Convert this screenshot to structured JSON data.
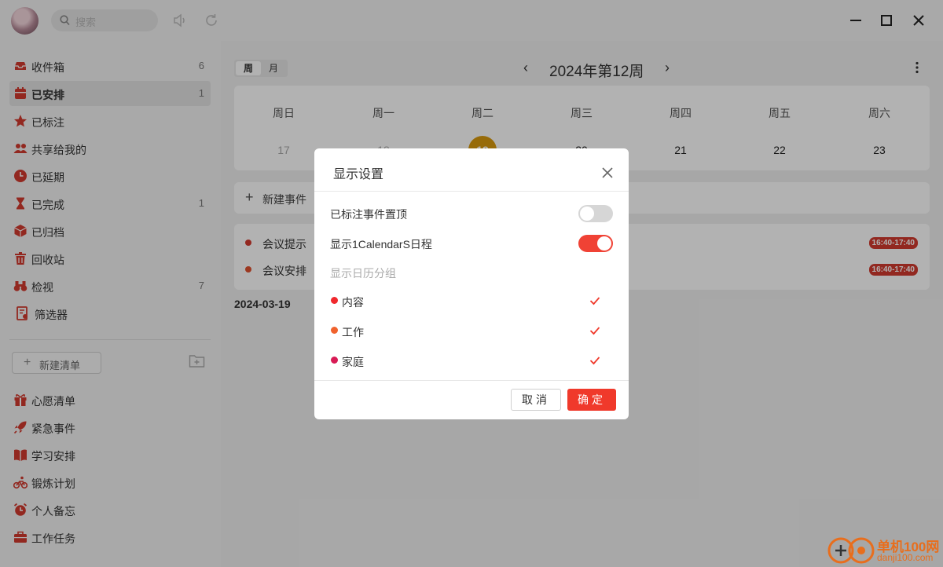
{
  "titlebar": {
    "search_placeholder": "搜索"
  },
  "sidebar": {
    "smart_lists": [
      {
        "label": "收件箱",
        "count": "6",
        "icon": "inbox-icon"
      },
      {
        "label": "已安排",
        "count": "1",
        "icon": "calendar-icon",
        "active": true
      },
      {
        "label": "已标注",
        "count": "",
        "icon": "star-icon"
      },
      {
        "label": "共享给我的",
        "count": "",
        "icon": "people-icon"
      },
      {
        "label": "已延期",
        "count": "",
        "icon": "clock-icon"
      },
      {
        "label": "已完成",
        "count": "1",
        "icon": "hourglass-icon"
      },
      {
        "label": "已归档",
        "count": "",
        "icon": "box-icon"
      },
      {
        "label": "回收站",
        "count": "",
        "icon": "trash-icon"
      },
      {
        "label": "检视",
        "count": "7",
        "icon": "binoculars-icon"
      },
      {
        "label": "筛选器",
        "count": "",
        "icon": "filter-doc-icon"
      }
    ],
    "new_list_label": "新建清单",
    "custom_lists": [
      {
        "label": "心愿清单",
        "icon": "gift-icon"
      },
      {
        "label": "紧急事件",
        "icon": "rocket-icon"
      },
      {
        "label": "学习安排",
        "icon": "book-icon"
      },
      {
        "label": "锻炼计划",
        "icon": "bike-icon"
      },
      {
        "label": "个人备忘",
        "icon": "alarm-icon"
      },
      {
        "label": "工作任务",
        "icon": "briefcase-icon"
      }
    ]
  },
  "main": {
    "view_toggle": {
      "week": "周",
      "month": "月"
    },
    "week_title": "2024年第12周",
    "days": [
      {
        "name": "周日",
        "date": "17",
        "state": "past"
      },
      {
        "name": "周一",
        "date": "18",
        "state": "past"
      },
      {
        "name": "周二",
        "date": "19",
        "state": "today"
      },
      {
        "name": "周三",
        "date": "20",
        "state": "future"
      },
      {
        "name": "周四",
        "date": "21",
        "state": "future"
      },
      {
        "name": "周五",
        "date": "22",
        "state": "future"
      },
      {
        "name": "周六",
        "date": "23",
        "state": "future"
      }
    ],
    "new_event_label": "新建事件",
    "events": [
      {
        "title": "会议提示",
        "time": "16:40-17:40",
        "color": "#d33a2f"
      },
      {
        "title": "会议安排",
        "time": "16:40-17:40",
        "color": "#e0512f"
      }
    ],
    "date_label": "2024-03-19"
  },
  "dialog": {
    "title": "显示设置",
    "options": [
      {
        "label": "已标注事件置顶",
        "on": false
      },
      {
        "label": "显示1CalendarS日程",
        "on": true
      }
    ],
    "group_header": "显示日历分组",
    "groups": [
      {
        "label": "内容",
        "color": "#f0282d",
        "checked": true
      },
      {
        "label": "工作",
        "color": "#f0622d",
        "checked": true
      },
      {
        "label": "家庭",
        "color": "#d81b55",
        "checked": true
      }
    ],
    "cancel_label": "取消",
    "ok_label": "确定"
  },
  "watermark": {
    "line1": "单机100网",
    "line2": "danji100.com"
  },
  "colors": {
    "accent": "#f0392b",
    "today": "#d99a0d"
  }
}
